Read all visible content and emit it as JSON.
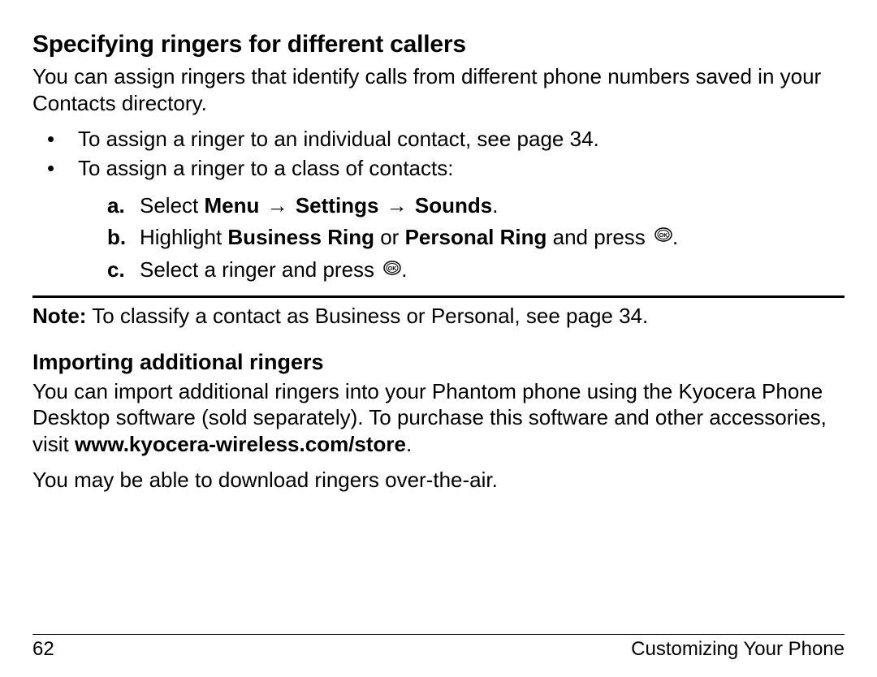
{
  "section1": {
    "title": "Specifying ringers for different callers",
    "intro": "You can assign ringers that identify calls from different phone numbers saved in your Contacts directory.",
    "bullet1": "To assign a ringer to an individual contact, see page 34.",
    "bullet2": "To assign a ringer to a class of contacts:",
    "step_a_marker": "a.",
    "step_a_pre": "Select ",
    "step_a_menu": "Menu",
    "step_a_arrow": " → ",
    "step_a_settings": "Settings",
    "step_a_sounds": "Sounds",
    "step_a_period": ".",
    "step_b_marker": "b.",
    "step_b_pre": "Highlight ",
    "step_b_business": "Business Ring",
    "step_b_or": " or ",
    "step_b_personal": "Personal Ring",
    "step_b_post": " and press ",
    "step_b_period": ".",
    "step_c_marker": "c.",
    "step_c_text": "Select a ringer and press ",
    "step_c_period": "."
  },
  "note": {
    "label": "Note:",
    "text": " To classify a contact as Business or Personal, see page 34."
  },
  "section2": {
    "title": "Importing additional ringers",
    "para1_pre": "You can import additional ringers into your Phantom phone using the Kyocera Phone Desktop software (sold separately). To purchase this software and other accessories, visit ",
    "para1_url": "www.kyocera-wireless.com/store",
    "para1_post": ".",
    "para2": "You may be able to download ringers over-the-air."
  },
  "footer": {
    "page": "62",
    "chapter": "Customizing Your Phone"
  }
}
